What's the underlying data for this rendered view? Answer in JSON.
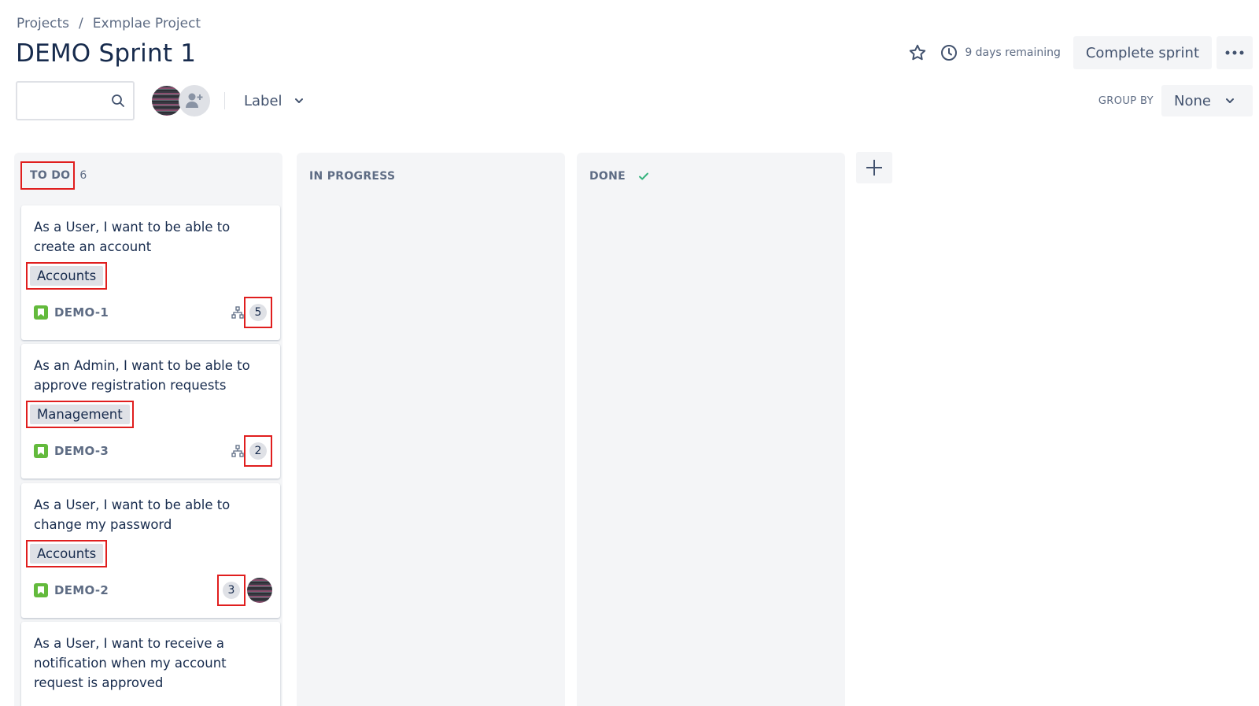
{
  "breadcrumb": {
    "projects": "Projects",
    "separator": "/",
    "project": "Exmplae Project"
  },
  "page": {
    "title": "DEMO Sprint 1"
  },
  "header": {
    "days_remaining": "9 days remaining",
    "complete_sprint": "Complete sprint"
  },
  "toolbar": {
    "search_placeholder": "",
    "label_filter": "Label",
    "group_by_label": "GROUP BY",
    "group_by_value": "None"
  },
  "columns": [
    {
      "title": "TO DO",
      "count": "6"
    },
    {
      "title": "IN PROGRESS",
      "count": ""
    },
    {
      "title": "DONE",
      "count": ""
    }
  ],
  "cards": [
    {
      "title": "As a User, I want to be able to create an account",
      "label": "Accounts",
      "key": "DEMO-1",
      "points": "5",
      "has_subtasks": true,
      "assignee": false
    },
    {
      "title": "As an Admin, I want to be able to approve registration requests",
      "label": "Management",
      "key": "DEMO-3",
      "points": "2",
      "has_subtasks": true,
      "assignee": false
    },
    {
      "title": "As a User, I want to be able to change my password",
      "label": "Accounts",
      "key": "DEMO-2",
      "points": "3",
      "has_subtasks": false,
      "assignee": true
    },
    {
      "title": "As a User, I want to receive a notification when my account request is approved"
    }
  ],
  "icons": {
    "star": "star-icon",
    "clock": "clock-icon",
    "more": "more-icon",
    "search": "search-icon",
    "add_people": "add-people-icon",
    "chevron": "chevron-down-icon",
    "check": "check-icon",
    "plus": "plus-icon",
    "story": "story-icon",
    "subtask": "subtask-icon"
  },
  "colors": {
    "story_green": "#63ba3c",
    "done_check": "#36b37e",
    "highlight_red": "#e01e1e"
  }
}
